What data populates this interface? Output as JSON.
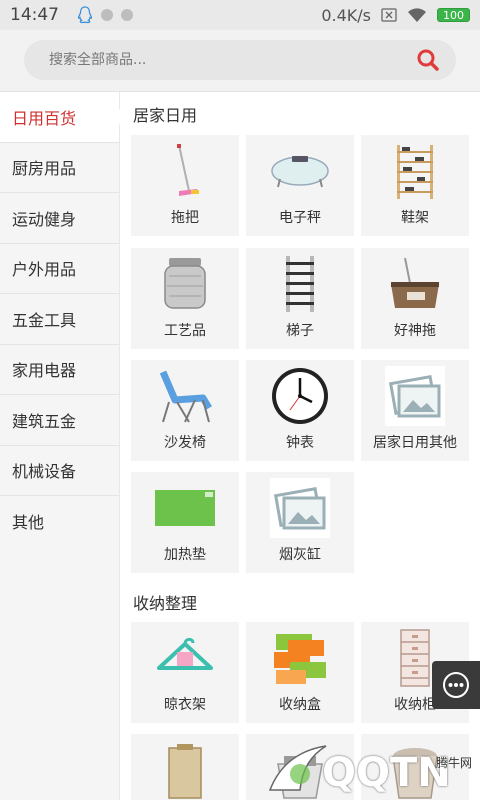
{
  "status_bar": {
    "time": "14:47",
    "network_speed": "0.4K/s",
    "battery": "100",
    "icons": [
      "qq-icon",
      "dot-icon",
      "dot-icon",
      "sim-icon",
      "wifi-icon",
      "battery-icon"
    ]
  },
  "search": {
    "placeholder": "搜索全部商品...",
    "value": "",
    "icon": "search-icon",
    "accent": "#e03a3a"
  },
  "sidebar": {
    "items": [
      {
        "label": "日用百货",
        "active": true
      },
      {
        "label": "厨房用品",
        "active": false
      },
      {
        "label": "运动健身",
        "active": false
      },
      {
        "label": "户外用品",
        "active": false
      },
      {
        "label": "五金工具",
        "active": false
      },
      {
        "label": "家用电器",
        "active": false
      },
      {
        "label": "建筑五金",
        "active": false
      },
      {
        "label": "机械设备",
        "active": false
      },
      {
        "label": "其他",
        "active": false
      }
    ],
    "active_color": "#d32f2f"
  },
  "sections": [
    {
      "title": "居家日用",
      "items": [
        {
          "label": "拖把",
          "icon": "mop-icon"
        },
        {
          "label": "电子秤",
          "icon": "scale-icon"
        },
        {
          "label": "鞋架",
          "icon": "shoe-rack-icon"
        },
        {
          "label": "工艺品",
          "icon": "canister-icon"
        },
        {
          "label": "梯子",
          "icon": "ladder-icon"
        },
        {
          "label": "好神拖",
          "icon": "spin-mop-icon"
        },
        {
          "label": "沙发椅",
          "icon": "lounge-chair-icon"
        },
        {
          "label": "钟表",
          "icon": "clock-icon"
        },
        {
          "label": "居家日用其他",
          "icon": "image-placeholder-icon"
        },
        {
          "label": "加热垫",
          "icon": "heating-pad-icon"
        },
        {
          "label": "烟灰缸",
          "icon": "image-placeholder-icon"
        }
      ]
    },
    {
      "title": "收纳整理",
      "items": [
        {
          "label": "晾衣架",
          "icon": "hanger-icon"
        },
        {
          "label": "收纳盒",
          "icon": "storage-box-icon"
        },
        {
          "label": "收纳柜",
          "icon": "drawer-cabinet-icon"
        },
        {
          "label": "",
          "icon": "storage-bag-icon"
        },
        {
          "label": "",
          "icon": "basket-icon"
        },
        {
          "label": "",
          "icon": "bucket-icon"
        }
      ]
    }
  ],
  "floating_button": {
    "icon": "chat-more-icon"
  },
  "watermark": {
    "text": "QQTN",
    "small_text": "腾牛网"
  }
}
